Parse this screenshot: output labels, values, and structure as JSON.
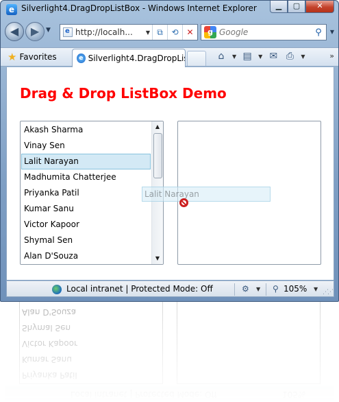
{
  "window": {
    "title": "Silverlight4.DragDropListBox - Windows Internet Explorer",
    "minimize": "▁",
    "maximize": "▢",
    "close": "✕"
  },
  "nav": {
    "back_icon": "◀",
    "forward_icon": "▶",
    "dropdown": "▼",
    "address": "http://localh...",
    "compat_icon": "⧉",
    "refresh_icon": "⟲",
    "stop_icon": "✕",
    "search_placeholder": "Google",
    "search_icon": "⚲"
  },
  "command_bar": {
    "favorites": "Favorites",
    "tab_title": "Silverlight4.DragDropLis...",
    "home_icon": "⌂",
    "feeds_icon": "▤",
    "mail_icon": "✉",
    "print_icon": "⎙",
    "more": "»"
  },
  "page": {
    "heading": "Drag & Drop ListBox Demo",
    "source_list": [
      "Akash Sharma",
      "Vinay Sen",
      "Lalit Narayan",
      "Madhumita Chatterjee",
      "Priyanka Patil",
      "Kumar Sanu",
      "Victor Kapoor",
      "Shymal Sen",
      "Alan D'Souza"
    ],
    "selected_item": "Lalit Narayan",
    "drag_item": "Lalit Narayan",
    "scroll_up": "▲",
    "scroll_down": "▼"
  },
  "status": {
    "zone": "Local intranet | Protected Mode: Off",
    "zoom": "105%",
    "dropdown": "▼"
  },
  "colors": {
    "heading": "#ff0000",
    "selection_bg": "#d3e9f5",
    "selection_border": "#88c2dd"
  }
}
